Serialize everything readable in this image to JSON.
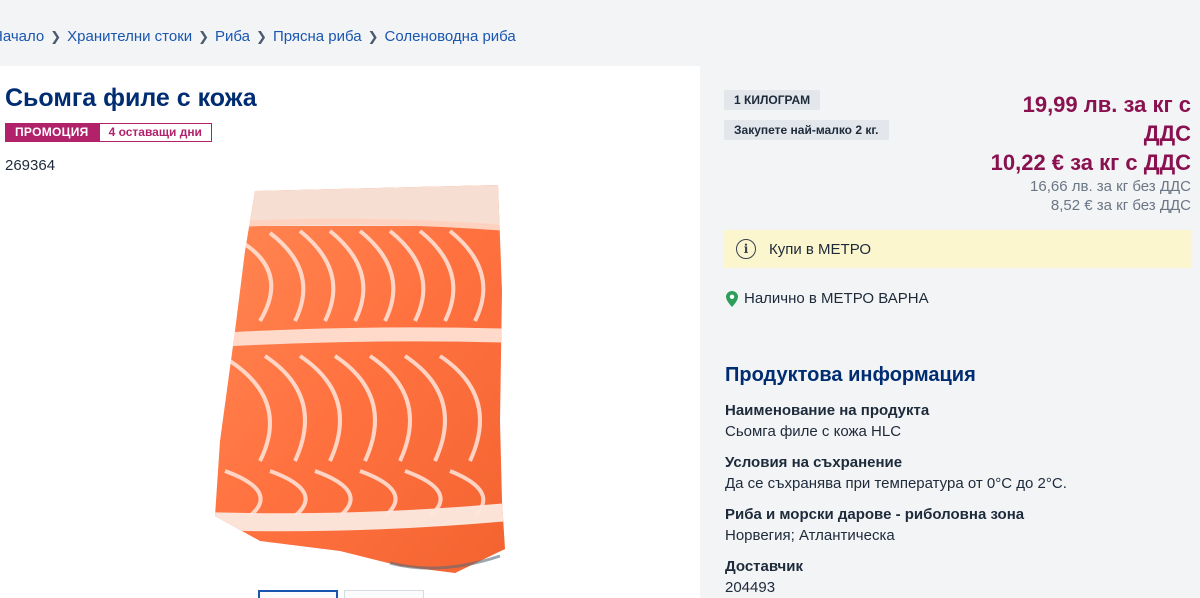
{
  "breadcrumb": [
    "Начало",
    "Хранителни стоки",
    "Риба",
    "Прясна риба",
    "Соленоводна риба"
  ],
  "product": {
    "title": "Сьомга филе с кожа",
    "promo_label": "ПРОМОЦИЯ",
    "days_left": "4 оставащи дни",
    "article_number": "269364"
  },
  "purchase": {
    "unit": "1 КИЛОГРАМ",
    "minimum": "Закупете най-малко 2 кг.",
    "price_bgn_line1": "19,99 лв. за кг с",
    "price_bgn_line2": "ДДС",
    "price_eur": "10,22 € за кг с ДДС",
    "net_bgn": "16,66 лв. за кг без ДДС",
    "net_eur": "8,52 € за кг без ДДС",
    "buy_in_store": "Купи в МЕТРО",
    "availability": "Налично в МЕТРО ВАРНА"
  },
  "product_info": {
    "heading": "Продуктова информация",
    "attributes": [
      {
        "label": "Наименование на продукта",
        "value": "Сьомга филе с кожа HLC"
      },
      {
        "label": "Условия на съхранение",
        "value": "Да се съхранява при температура от 0°C до 2°C."
      },
      {
        "label": "Риба и морски дарове - риболовна зона",
        "value": "Норвегия; Атлантическа"
      },
      {
        "label": "Доставчик",
        "value": "204493"
      }
    ]
  },
  "colors": {
    "brand_blue": "#002d72",
    "promo_magenta": "#b1226a",
    "price_color": "#8a1150",
    "info_yellow": "#fcf6cf"
  },
  "icons": [
    "chevron-right-icon",
    "info-icon",
    "location-pin-icon"
  ]
}
